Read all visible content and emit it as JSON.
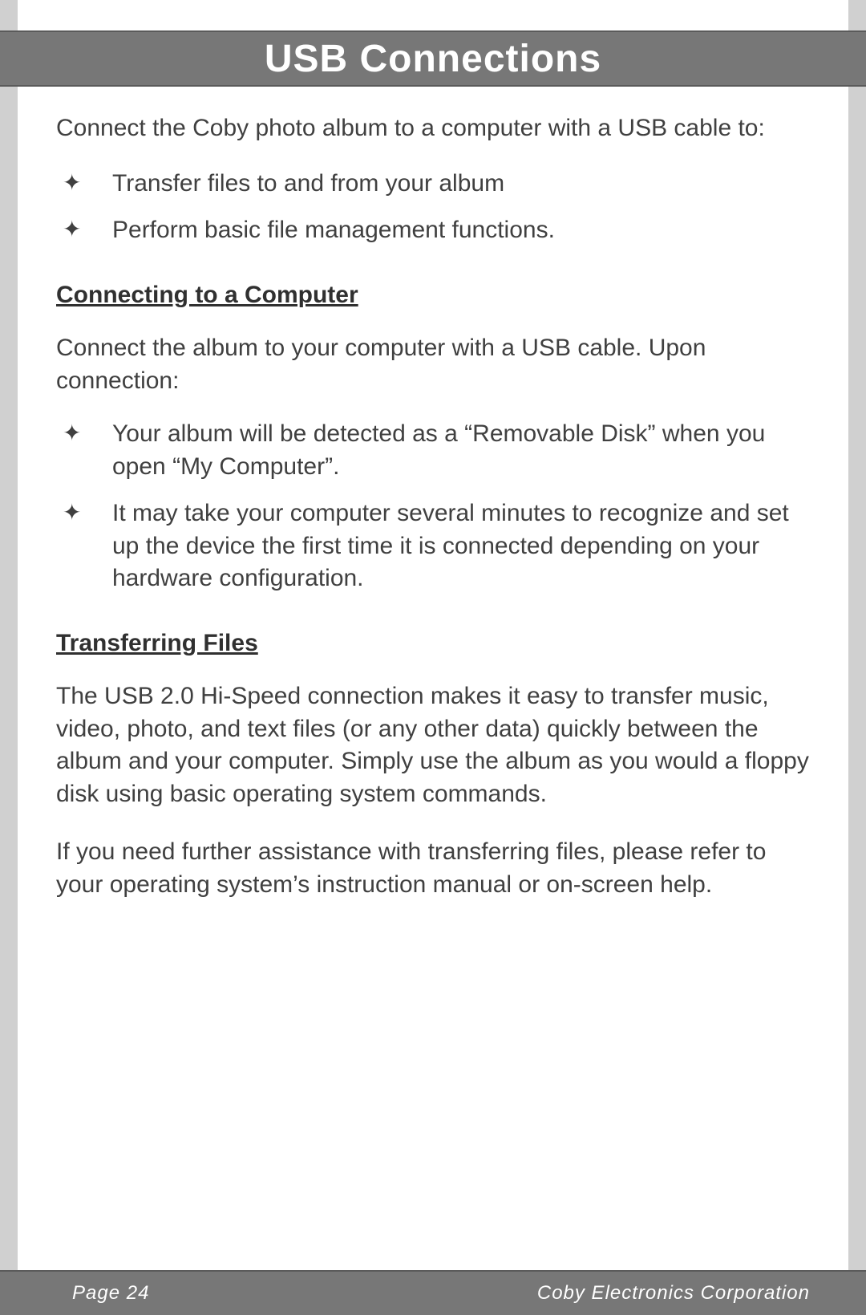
{
  "title": "USB Connections",
  "intro": "Connect the Coby photo album to a computer with a USB cable to:",
  "intro_bullets": [
    "Transfer files to and from your album",
    "Perform basic file management functions."
  ],
  "section1": {
    "heading": "Connecting to a Computer",
    "para": "Connect the album to your computer with a USB cable. Upon connection:",
    "bullets": [
      "Your album will be detected as a “Removable Disk” when you open “My Computer”.",
      "It may take your computer several minutes to recognize and set up the device the first time it is connected depending on your hardware configuration."
    ]
  },
  "section2": {
    "heading": "Transferring Files",
    "para1": "The USB 2.0 Hi-Speed connection makes it easy to transfer music, video, photo, and text files (or any other data) quickly between the album and your computer. Simply use the album as you would a floppy disk using basic operating system commands.",
    "para2": "If you need further assistance with transferring files, please refer to your operating system’s instruction manual or on-screen help."
  },
  "footer": {
    "page": "Page 24",
    "company": "Coby Electronics Corporation"
  }
}
